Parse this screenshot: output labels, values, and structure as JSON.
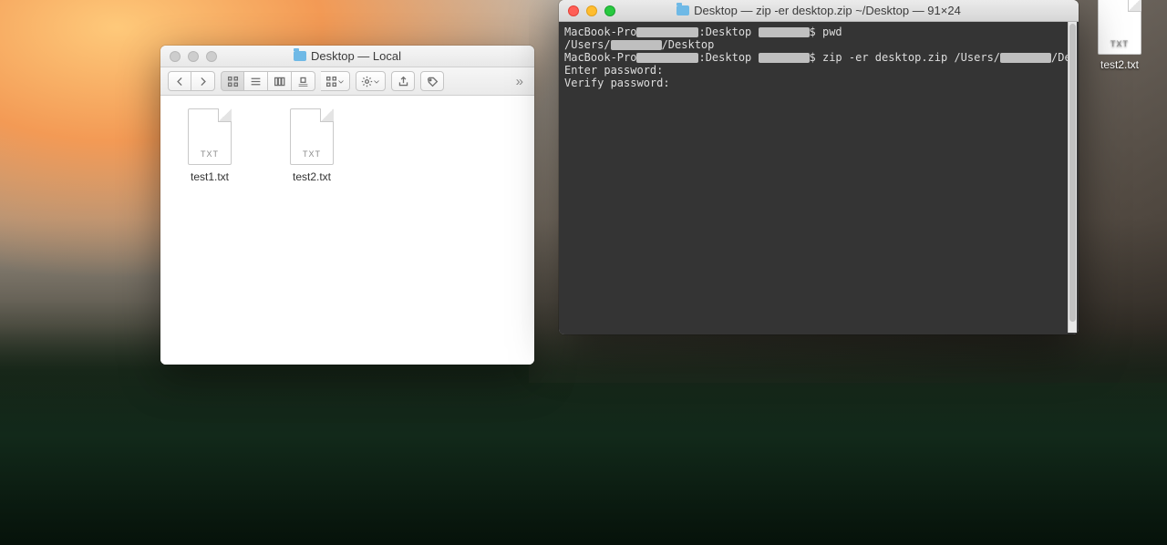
{
  "desktop": {
    "items": [
      {
        "name": "test2.txt",
        "ext": "TXT"
      }
    ]
  },
  "finder": {
    "title": "Desktop — Local",
    "files": [
      {
        "name": "test1.txt",
        "ext": "TXT"
      },
      {
        "name": "test2.txt",
        "ext": "TXT"
      }
    ]
  },
  "terminal": {
    "title": "Desktop — zip -er desktop.zip ~/Desktop — 91×24",
    "lines": {
      "l0_pre": "MacBook-Pro",
      "l0_mid": ":Desktop ",
      "l0_post": "$ pwd",
      "l1_pre": "/Users/",
      "l1_post": "/Desktop",
      "l2_pre": "MacBook-Pro",
      "l2_mid": ":Desktop ",
      "l2_cmd": "$ zip -er desktop.zip /Users/",
      "l2_tail": "/Desktop/",
      "l3": "Enter password:",
      "l4": "Verify password:"
    }
  }
}
